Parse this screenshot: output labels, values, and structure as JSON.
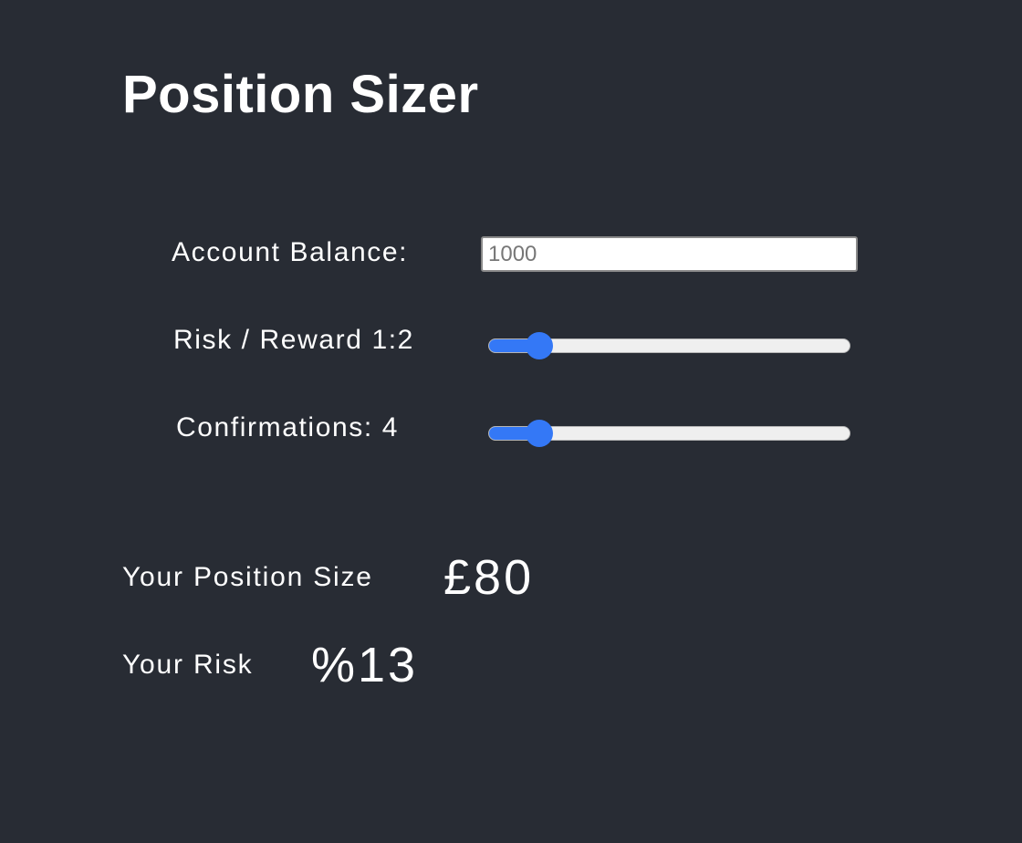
{
  "app": {
    "title": "Position Sizer"
  },
  "form": {
    "balance": {
      "label": "Account Balance:",
      "value": "",
      "placeholder": "1000"
    },
    "risk_reward": {
      "label": "Risk / Reward 1:2",
      "level_fraction": 0.14
    },
    "confirmations": {
      "label": "Confirmations: 4",
      "level_fraction": 0.14
    }
  },
  "results": {
    "position_size": {
      "label": "Your Position Size",
      "value": "£80"
    },
    "risk": {
      "label": "Your Risk",
      "value": "%13"
    }
  },
  "colors": {
    "background": "#282c34",
    "accent": "#3478f6",
    "text": "#ffffff"
  }
}
